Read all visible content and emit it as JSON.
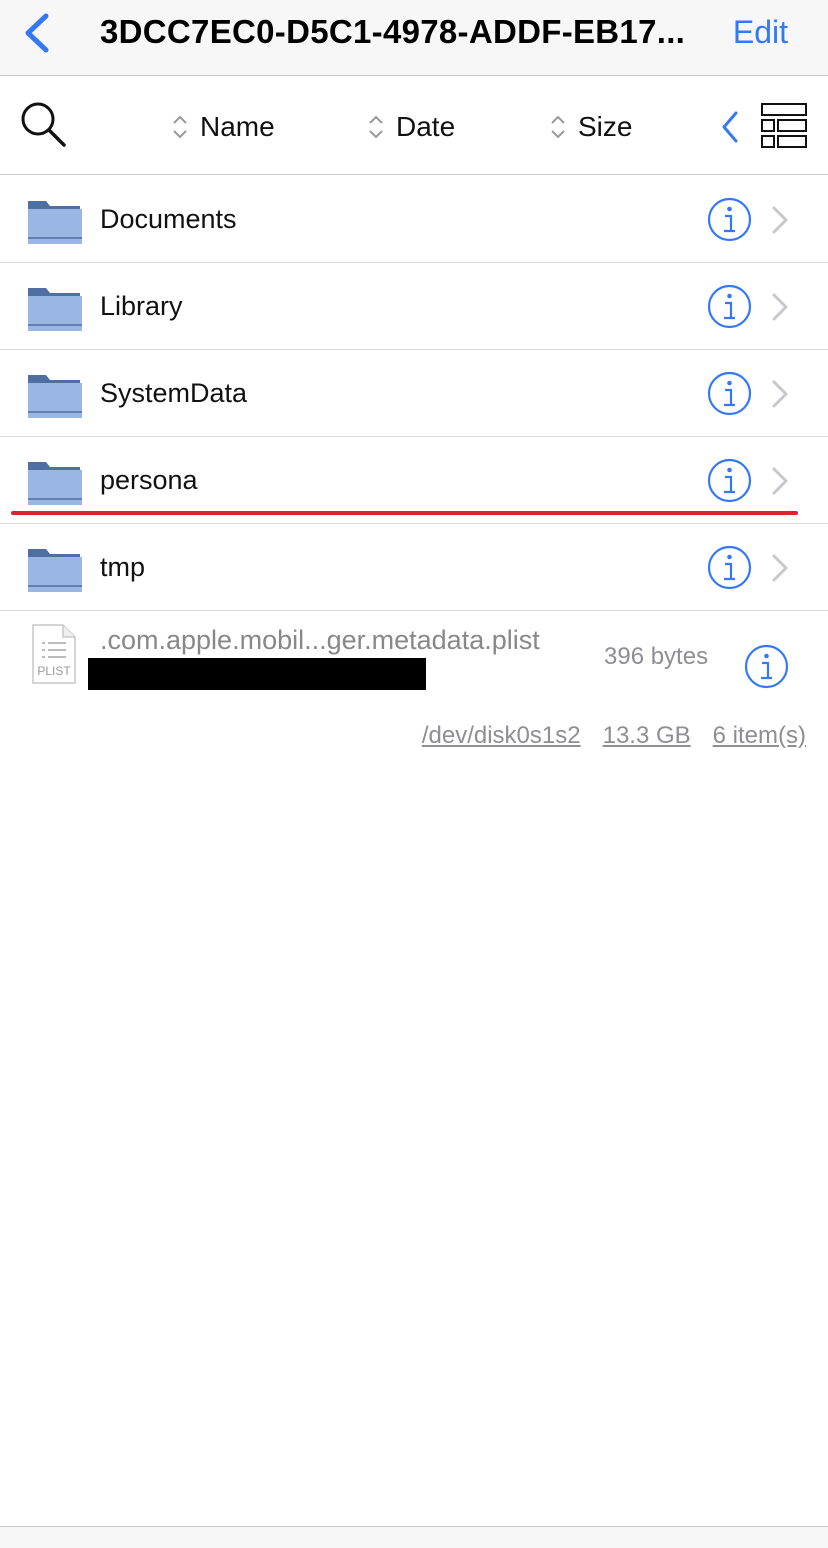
{
  "nav": {
    "back_icon": "chevron-left-icon",
    "title": "3DCC7EC0-D5C1-4978-ADDF-EB17...",
    "edit_label": "Edit",
    "accent_color": "#3478f6"
  },
  "toolbar": {
    "search_icon": "search-icon",
    "sort_columns": [
      {
        "label": "Name",
        "icon": "sort-updown-icon"
      },
      {
        "label": "Date",
        "icon": "sort-updown-icon"
      },
      {
        "label": "Size",
        "icon": "sort-updown-icon"
      }
    ],
    "collapse_icon": "chevron-left-icon",
    "layout_icon": "list-layout-icon"
  },
  "items": [
    {
      "name": "Documents",
      "type": "folder"
    },
    {
      "name": "Library",
      "type": "folder"
    },
    {
      "name": "SystemData",
      "type": "folder"
    },
    {
      "name": "persona",
      "type": "folder",
      "highlighted": true
    },
    {
      "name": "tmp",
      "type": "folder"
    }
  ],
  "file": {
    "name": ".com.apple.mobil...ger.metadata.plist",
    "icon_label": "PLIST",
    "size": "396 bytes",
    "redacted": true
  },
  "footer": {
    "device": "/dev/disk0s1s2",
    "capacity": "13.3 GB",
    "count": "6 item(s)"
  },
  "colors": {
    "highlight": "#e0222a",
    "folder": "#9ab6e2",
    "folder_tab": "#4f6fa3"
  }
}
